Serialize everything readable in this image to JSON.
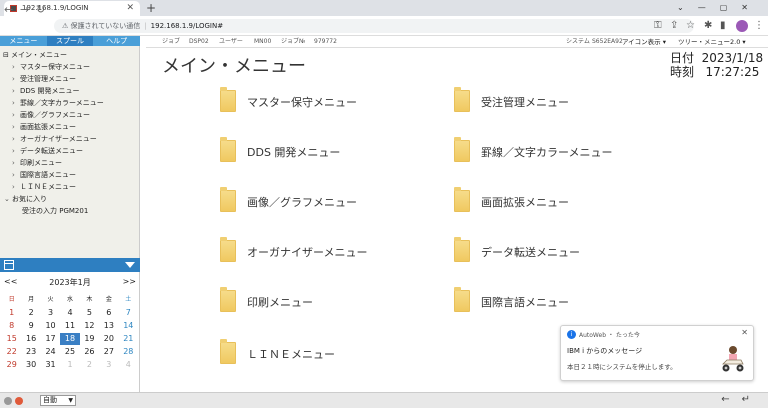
{
  "browser": {
    "tab_title": "192.168.1.9/LOGIN",
    "security_warning": "保護されていない通信",
    "url": "192.168.1.9/LOGIN#"
  },
  "menubar": {
    "items": [
      "メニュー",
      "スプール",
      "ヘルプ"
    ]
  },
  "tree": {
    "root": "メイン・メニュー",
    "items": [
      "マスター保守メニュー",
      "受注管理メニュー",
      "DDS 開発メニュー",
      "罫線／文字カラーメニュー",
      "画像／グラフメニュー",
      "画面拡張メニュー",
      "オーガナイザーメニュー",
      "データ転送メニュー",
      "印刷メニュー",
      "国際言語メニュー",
      "ＬＩＮＥメニュー"
    ],
    "favorites": "お気に入り",
    "favorite_items": [
      "受注の入力 PGM201"
    ]
  },
  "calendar": {
    "prev": "<<",
    "next": ">>",
    "title": "2023年1月",
    "weekdays": [
      "日",
      "月",
      "火",
      "水",
      "木",
      "金",
      "土"
    ],
    "days": [
      "1",
      "2",
      "3",
      "4",
      "5",
      "6",
      "7",
      "8",
      "9",
      "10",
      "11",
      "12",
      "13",
      "14",
      "15",
      "16",
      "17",
      "18",
      "19",
      "20",
      "21",
      "22",
      "23",
      "24",
      "25",
      "26",
      "27",
      "28",
      "29",
      "30",
      "31",
      "1",
      "2",
      "3",
      "4"
    ],
    "selected_day": "18"
  },
  "infobar": {
    "job_label": "ジョブ",
    "job_value": "DSP02",
    "user_label": "ユーザー",
    "user_value": "MN00",
    "jobno_label": "ジョブ№",
    "jobno_value": "979772",
    "system_label": "システム",
    "system_value": "S652EA92",
    "icon_view": "アイコン表示",
    "tree_menu": "ツリー・メニュー2.0"
  },
  "main": {
    "title": "メイン・メニュー",
    "date_label": "日付",
    "date_value": "2023/1/18",
    "time_label": "時刻",
    "time_value": "17:27:25",
    "items": [
      "マスター保守メニュー",
      "受注管理メニュー",
      "DDS 開発メニュー",
      "罫線／文字カラーメニュー",
      "画像／グラフメニュー",
      "画面拡張メニュー",
      "オーガナイザーメニュー",
      "データ転送メニュー",
      "印刷メニュー",
      "国際言語メニュー",
      "ＬＩＮＥメニュー"
    ]
  },
  "status": {
    "mode": "自動"
  },
  "toast": {
    "source": "AutoWeb ・ たった今",
    "title": "IBM i からのメッセージ",
    "message": "本日２１時にシステムを停止します。"
  },
  "colors": {
    "menubar": "#4a9fd8",
    "calendar_bar": "#2e7fc1",
    "selected_day": "#3a7fc4",
    "folder": "#f0c960"
  }
}
